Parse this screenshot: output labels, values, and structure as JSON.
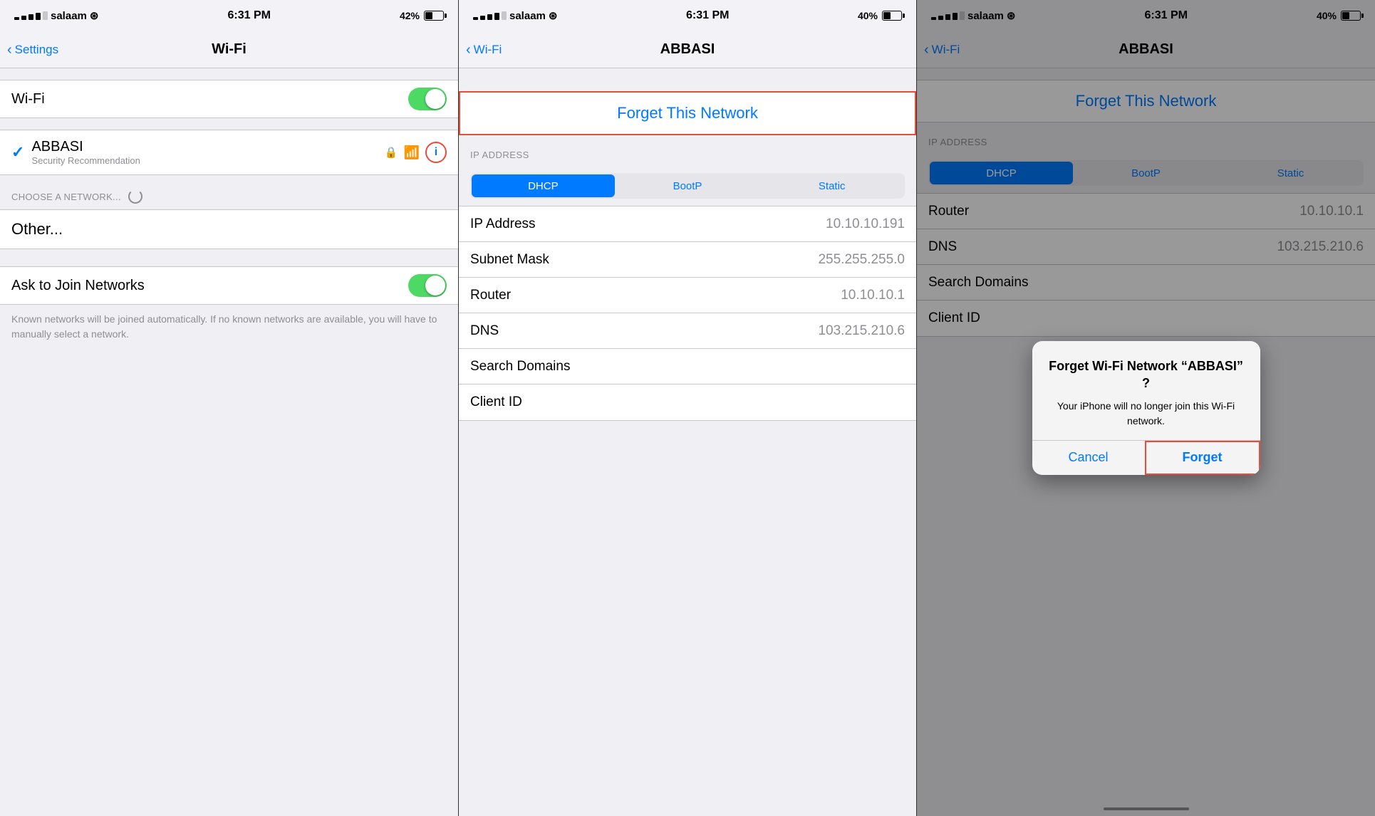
{
  "panel1": {
    "status": {
      "carrier": "salaam",
      "time": "6:31 PM",
      "battery": "42%",
      "battery_pct": 42
    },
    "nav": {
      "back_label": "Settings",
      "title": "Wi-Fi"
    },
    "wifi_row": {
      "label": "Wi-Fi",
      "enabled": true
    },
    "network": {
      "name": "ABBASI",
      "sublabel": "Security Recommendation"
    },
    "choose_header": "CHOOSE A NETWORK...",
    "other_label": "Other...",
    "ask_to_join": {
      "label": "Ask to Join Networks",
      "enabled": true,
      "description": "Known networks will be joined automatically. If no known networks are available, you will have to manually select a network."
    }
  },
  "panel2": {
    "status": {
      "carrier": "salaam",
      "time": "6:31 PM",
      "battery": "40%",
      "battery_pct": 40
    },
    "nav": {
      "back_label": "Wi-Fi",
      "title": "ABBASI"
    },
    "forget_label": "Forget This Network",
    "ip_section_header": "IP ADDRESS",
    "segments": [
      "DHCP",
      "BootP",
      "Static"
    ],
    "active_segment": 0,
    "fields": [
      {
        "label": "IP Address",
        "value": "10.10.10.191"
      },
      {
        "label": "Subnet Mask",
        "value": "255.255.255.0"
      },
      {
        "label": "Router",
        "value": "10.10.10.1"
      },
      {
        "label": "DNS",
        "value": "103.215.210.6"
      },
      {
        "label": "Search Domains",
        "value": ""
      },
      {
        "label": "Client ID",
        "value": ""
      }
    ]
  },
  "panel3": {
    "status": {
      "carrier": "salaam",
      "time": "6:31 PM",
      "battery": "40%",
      "battery_pct": 40
    },
    "nav": {
      "back_label": "Wi-Fi",
      "title": "ABBASI"
    },
    "forget_label": "Forget This Network",
    "ip_section_header": "IP ADDRESS",
    "segments": [
      "DHCP",
      "BootP",
      "Static"
    ],
    "active_segment": 0,
    "fields": [
      {
        "label": "Router",
        "value": "10.10.10.1"
      },
      {
        "label": "DNS",
        "value": "103.215.210.6"
      },
      {
        "label": "Search Domains",
        "value": ""
      },
      {
        "label": "Client ID",
        "value": ""
      }
    ],
    "dialog": {
      "title": "Forget Wi-Fi Network “ABBASI” ?",
      "message": "Your iPhone will no longer join this Wi-Fi network.",
      "cancel_label": "Cancel",
      "forget_label": "Forget"
    }
  },
  "icons": {
    "back_chevron": "‹",
    "checkmark": "✓",
    "lock": "🔒",
    "wifi": "📶",
    "info": "i"
  }
}
